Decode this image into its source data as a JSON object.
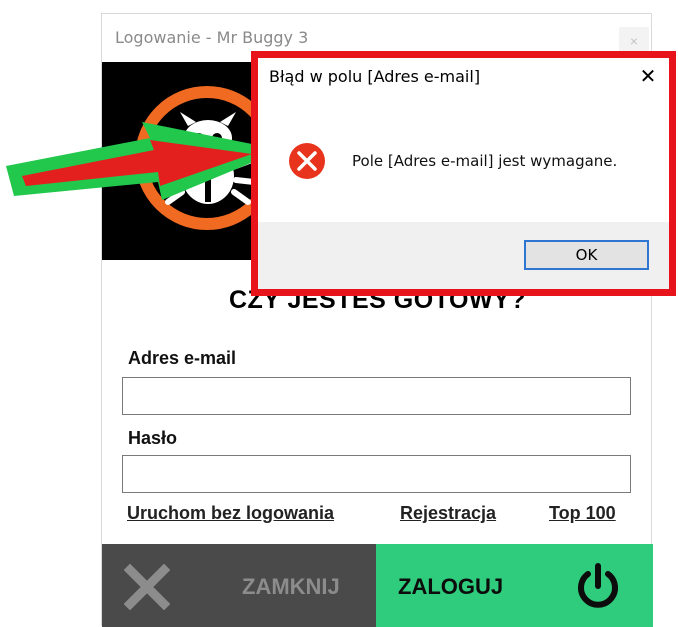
{
  "login_window": {
    "title": "Logowanie - Mr Buggy 3",
    "close_glyph": "×",
    "question": "CZY JESTEŚ GOTOWY?",
    "email_label": "Adres e-mail",
    "email_value": "",
    "password_label": "Hasło",
    "password_value": "",
    "links": {
      "no_login": "Uruchom bez logowania",
      "register": "Rejestracja",
      "top100": "Top 100"
    },
    "close_button_label": "ZAMKNIJ",
    "login_button_label": "ZALOGUJ",
    "icons": {
      "logo": "bug-logo-icon",
      "close": "x-icon",
      "power": "power-icon"
    }
  },
  "dialog": {
    "title": "Błąd w polu [Adres e-mail]",
    "close_glyph": "✕",
    "message": "Pole [Adres e-mail] jest wymagane.",
    "ok_label": "OK",
    "icon": "error-icon"
  },
  "colors": {
    "accent_green": "#2fcc7d",
    "dark_gray": "#4a4a4a",
    "highlight_red": "#e8141c",
    "logo_orange": "#f06a21",
    "arrow_green": "#22c84c"
  }
}
